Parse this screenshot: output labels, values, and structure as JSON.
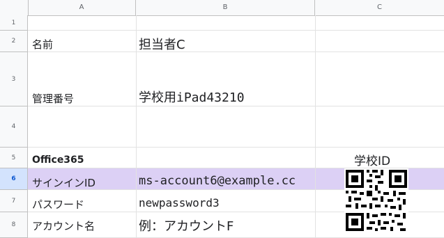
{
  "columns": [
    "A",
    "B",
    "C"
  ],
  "rows": [
    "1",
    "2",
    "3",
    "4",
    "5",
    "6",
    "7",
    "8"
  ],
  "cells": {
    "a2": "名前",
    "b2": "担当者C",
    "a3": "管理番号",
    "b3": "学校用iPad43210",
    "a5": "Office365",
    "c5": "学校ID",
    "a6": "サインインID",
    "b6": "ms-account6@example.cc",
    "a7": "パスワード",
    "b7": "newpassword3",
    "a8": "アカウント名",
    "b8": "例：アカウントF"
  },
  "selected_row": "6",
  "colors": {
    "selected_row": "#dcd0f5",
    "header_bg": "#f8f9fa"
  },
  "qr_icon": "qr-code-icon"
}
